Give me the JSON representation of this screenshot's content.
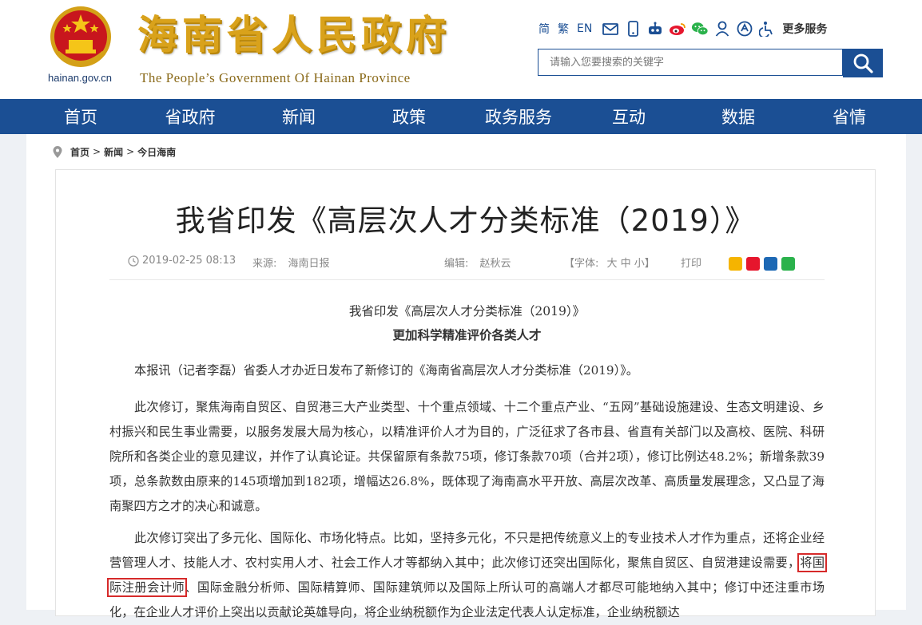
{
  "header": {
    "domain": "hainan.gov.cn",
    "title": "海南省人民政府",
    "subtitle": "The People’s Government Of Hainan Province",
    "topbar": {
      "simplified": "简",
      "traditional": "繁",
      "english": "EN",
      "more": "更多服务",
      "icons": [
        "mail-icon",
        "mobile-icon",
        "robot-icon",
        "weibo-icon",
        "wechat-icon",
        "user-icon",
        "accessibility-icon",
        "wheelchair-icon"
      ]
    },
    "search": {
      "placeholder": "请输入您要搜索的关键字"
    }
  },
  "nav": {
    "items": [
      "首页",
      "省政府",
      "新闻",
      "政策",
      "政务服务",
      "互动",
      "数据",
      "省情"
    ]
  },
  "breadcrumb": {
    "items": [
      "首页",
      "新闻",
      "今日海南"
    ],
    "separator": ">"
  },
  "article": {
    "title": "我省印发《高层次人才分类标准（2019）》",
    "meta": {
      "date": "2019-02-25 08:13",
      "source_label": "来源:",
      "source": "海南日报",
      "editor_label": "编辑:",
      "editor": "赵秋云",
      "font_label": "【字体:",
      "font_options": "大 中 小】",
      "print": "打印"
    },
    "subtitle1": "我省印发《高层次人才分类标准（2019）》",
    "subtitle2": "更加科学精准评价各类人才",
    "p1": "本报讯（记者李磊）省委人才办近日发布了新修订的《海南省高层次人才分类标准（2019）》。",
    "p2": "此次修订，聚焦海南自贸区、自贸港三大产业类型、十个重点领域、十二个重点产业、“五网”基础设施建设、生态文明建设、乡村振兴和民生事业需要，以服务发展大局为核心，以精准评价人才为目的，广泛征求了各市县、省直有关部门以及高校、医院、科研院所和各类企业的意见建议，并作了认真论证。共保留原有条款75项，修订条款70项（合并2项），修订比例达48.2%；新增条款39项，总条款数由原来的145项增加到182项，增幅达26.8%，既体现了海南高水平开放、高层次改革、高质量发展理念，又凸显了海南聚四方之才的决心和诚意。",
    "p3a": "此次修订突出了多元化、国际化、市场化特点。比如，坚持多元化，不只是把传统意义上的专业技术人才作为重点，还将企业经营管理人才、技能人才、农村实用人才、社会工作人才等都纳入其中；此次修订还突出国际化，聚焦自贸区、自贸港建设需要，",
    "p3_highlight": "将国际注册会计师",
    "p3b": "、国际金融分析师、国际精算师、国际建筑师以及国际上所认可的高端人才都尽可能地纳入其中；修订中还注重市场化，在企业人才评价上突出以贡献论英雄导向，将企业纳税额作为企业法定代表人认定标准，企业纳税额达"
  },
  "colors": {
    "nav": "#1b4f94",
    "title_gold": "#d9a21b",
    "highlight": "#d62a2a"
  }
}
